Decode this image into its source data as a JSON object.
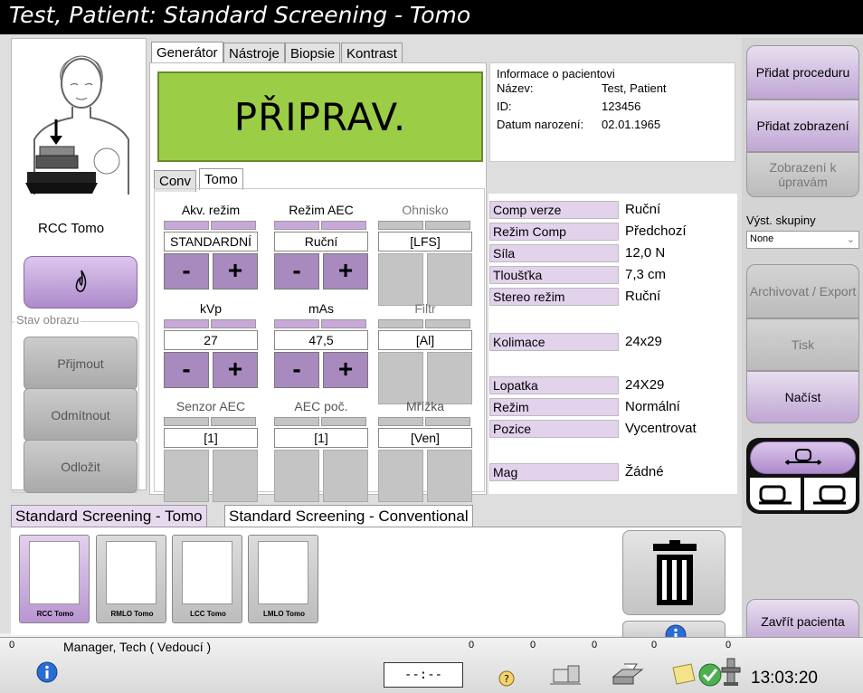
{
  "title": "Test, Patient:  Standard Screening - Tomo",
  "patient_panel": {
    "view_label": "RCC Tomo",
    "image_status_legend": "Stav obrazu",
    "accept": "Přijmout",
    "reject": "Odmítnout",
    "defer": "Odložit"
  },
  "tabs": [
    "Generátor",
    "Nástroje",
    "Biopsie",
    "Kontrast"
  ],
  "status_display": "PŘIPRAV.",
  "patient_info": {
    "heading": "Informace o pacientovi",
    "name_label": "Název:",
    "name": "Test, Patient",
    "id_label": "ID:",
    "id": "123456",
    "dob_label": "Datum narození:",
    "dob": "02.01.1965"
  },
  "mode_tabs": [
    "Conv",
    "Tomo"
  ],
  "controls": {
    "acq_mode": {
      "label": "Akv. režim",
      "value": "STANDARDNÍ"
    },
    "aec_mode": {
      "label": "Režim AEC",
      "value": "Ruční"
    },
    "focus": {
      "label": "Ohnisko",
      "value": "[LFS]"
    },
    "kvp": {
      "label": "kVp",
      "value": "27"
    },
    "mas": {
      "label": "mAs",
      "value": "47,5"
    },
    "filter": {
      "label": "Filtr",
      "value": "[Al]"
    },
    "aec_sensor": {
      "label": "Senzor AEC",
      "value": "[1]"
    },
    "aec_count": {
      "label": "AEC poč.",
      "value": "[1]"
    },
    "grid": {
      "label": "Mřížka",
      "value": "[Ven]"
    },
    "minus": "-",
    "plus": "+"
  },
  "params": [
    {
      "key": "Comp verze",
      "value": "Ruční"
    },
    {
      "key": "Režim Comp",
      "value": "Předchozí"
    },
    {
      "key": "Síla",
      "value": "12,0 N"
    },
    {
      "key": "Tloušťka",
      "value": "7,3 cm"
    },
    {
      "key": "Stereo režim",
      "value": "Ruční"
    },
    {
      "key": "Kolimace",
      "value": "24x29"
    },
    {
      "key": "Lopatka",
      "value": "24X29"
    },
    {
      "key": "Režim",
      "value": "Normální"
    },
    {
      "key": "Pozice",
      "value": "Vycentrovat"
    },
    {
      "key": "Mag",
      "value": "Žádné"
    }
  ],
  "sidebar": {
    "add_procedure": "Přidat proceduru",
    "add_view": "Přidat zobrazení",
    "edit_view": "Zobrazení k úpravám",
    "output_groups_label": "Výst. skupiny",
    "output_groups_value": "None",
    "archive": "Archivovat / Export",
    "print": "Tisk",
    "load": "Načíst",
    "close_patient": "Zavřít pacienta"
  },
  "procedure_tabs": [
    "Standard Screening - Tomo",
    "Standard Screening - Conventional"
  ],
  "thumbnails": [
    "RCC Tomo",
    "RMLO Tomo",
    "LCC Tomo",
    "LMLO Tomo"
  ],
  "statusbar": {
    "user_count": "0",
    "user": "Manager, Tech ( Vedoucí )",
    "timer": "--:--",
    "count1": "0",
    "count2": "0",
    "count3": "0",
    "count4": "0",
    "count5": "0",
    "time": "13:03:20"
  },
  "colors": {
    "display_green": "#9ccd47",
    "accent_purple": "#a98abf",
    "label_lilac": "#e2d2ec"
  }
}
